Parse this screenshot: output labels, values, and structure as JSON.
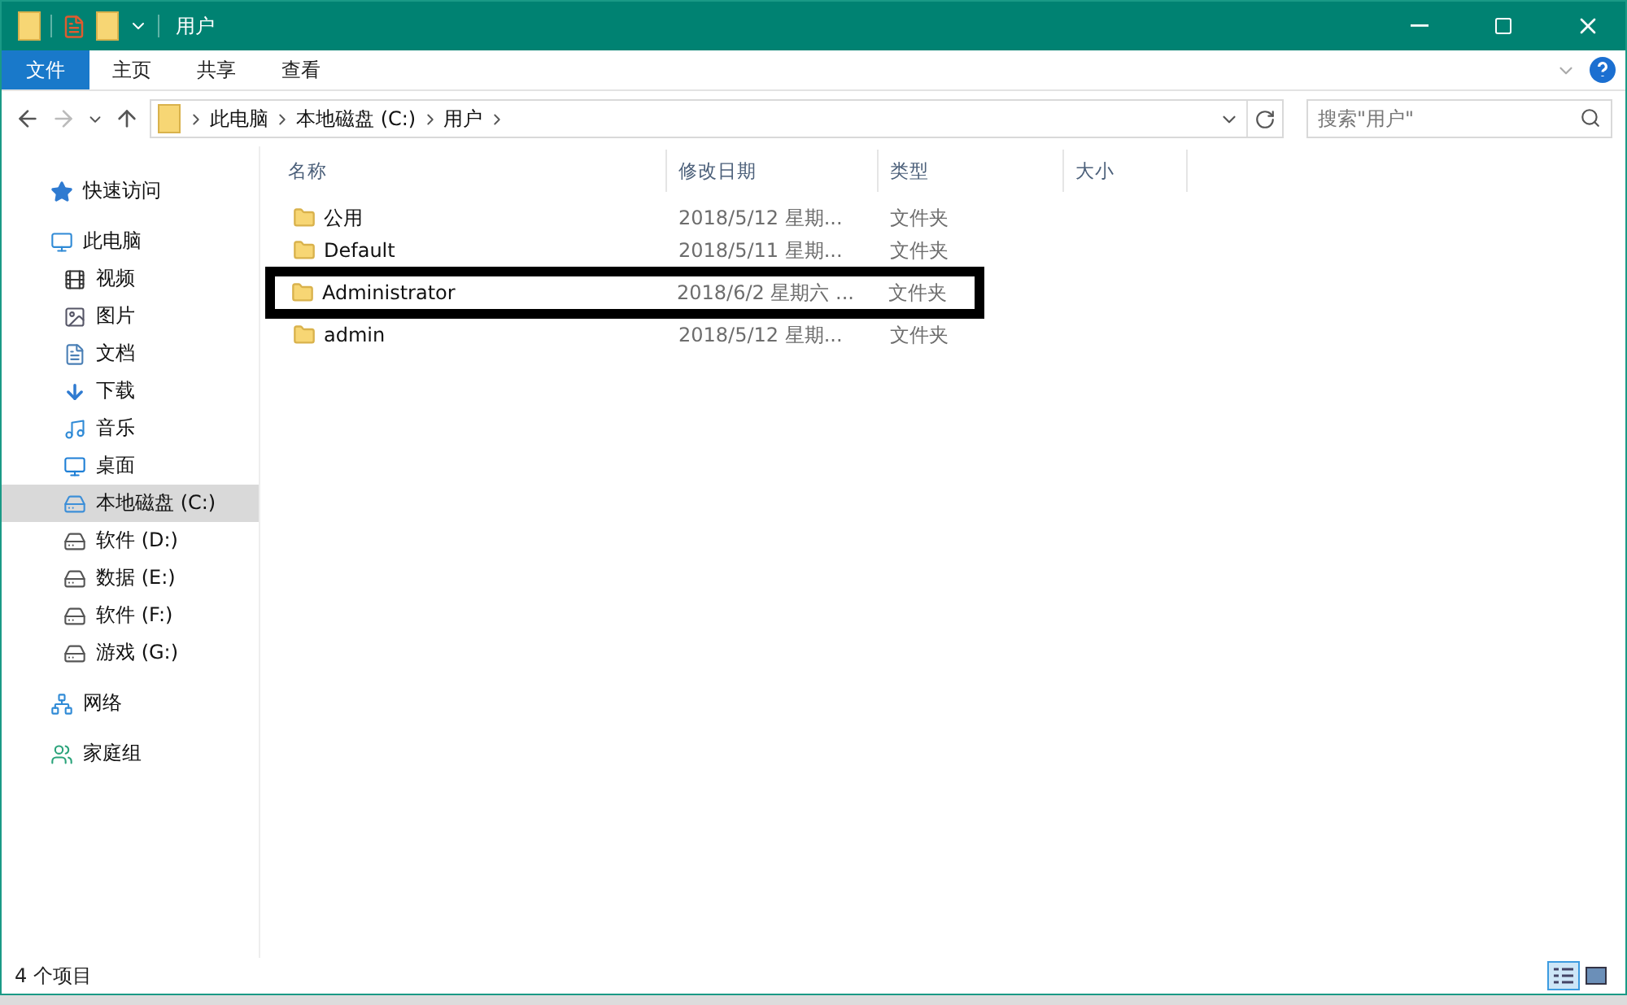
{
  "window": {
    "title": "用户"
  },
  "ribbon_tabs": [
    {
      "label": "文件",
      "selected": true
    },
    {
      "label": "主页",
      "selected": false
    },
    {
      "label": "共享",
      "selected": false
    },
    {
      "label": "查看",
      "selected": false
    }
  ],
  "address": {
    "crumbs": [
      "此电脑",
      "本地磁盘 (C:)",
      "用户"
    ]
  },
  "search": {
    "placeholder": "搜索\"用户\""
  },
  "sidebar": {
    "items": [
      {
        "label": "快速访问",
        "kind": "star",
        "selected": false
      },
      {
        "label": "此电脑",
        "kind": "pc",
        "selected": false,
        "children": [
          {
            "label": "视频",
            "kind": "video",
            "selected": false
          },
          {
            "label": "图片",
            "kind": "picture",
            "selected": false
          },
          {
            "label": "文档",
            "kind": "doc",
            "selected": false
          },
          {
            "label": "下载",
            "kind": "download",
            "selected": false
          },
          {
            "label": "音乐",
            "kind": "music",
            "selected": false
          },
          {
            "label": "桌面",
            "kind": "desktop",
            "selected": false
          },
          {
            "label": "本地磁盘 (C:)",
            "kind": "sysdrive",
            "selected": true
          },
          {
            "label": "软件 (D:)",
            "kind": "drive",
            "selected": false
          },
          {
            "label": "数据 (E:)",
            "kind": "drive",
            "selected": false
          },
          {
            "label": "软件 (F:)",
            "kind": "drive",
            "selected": false
          },
          {
            "label": "游戏 (G:)",
            "kind": "drive",
            "selected": false
          }
        ]
      },
      {
        "label": "网络",
        "kind": "network",
        "selected": false
      },
      {
        "label": "家庭组",
        "kind": "homegroup",
        "selected": false
      }
    ]
  },
  "table": {
    "columns": [
      "名称",
      "修改日期",
      "类型",
      "大小"
    ],
    "rows": [
      {
        "name": "公用",
        "date": "2018/5/12 星期...",
        "type": "文件夹",
        "highlighted": false
      },
      {
        "name": "Default",
        "date": "2018/5/11 星期...",
        "type": "文件夹",
        "highlighted": false
      },
      {
        "name": "Administrator",
        "date": "2018/6/2 星期六 ...",
        "type": "文件夹",
        "highlighted": true
      },
      {
        "name": "admin",
        "date": "2018/5/12 星期...",
        "type": "文件夹",
        "highlighted": false
      }
    ]
  },
  "status_bar": {
    "count": "4 个项目"
  }
}
